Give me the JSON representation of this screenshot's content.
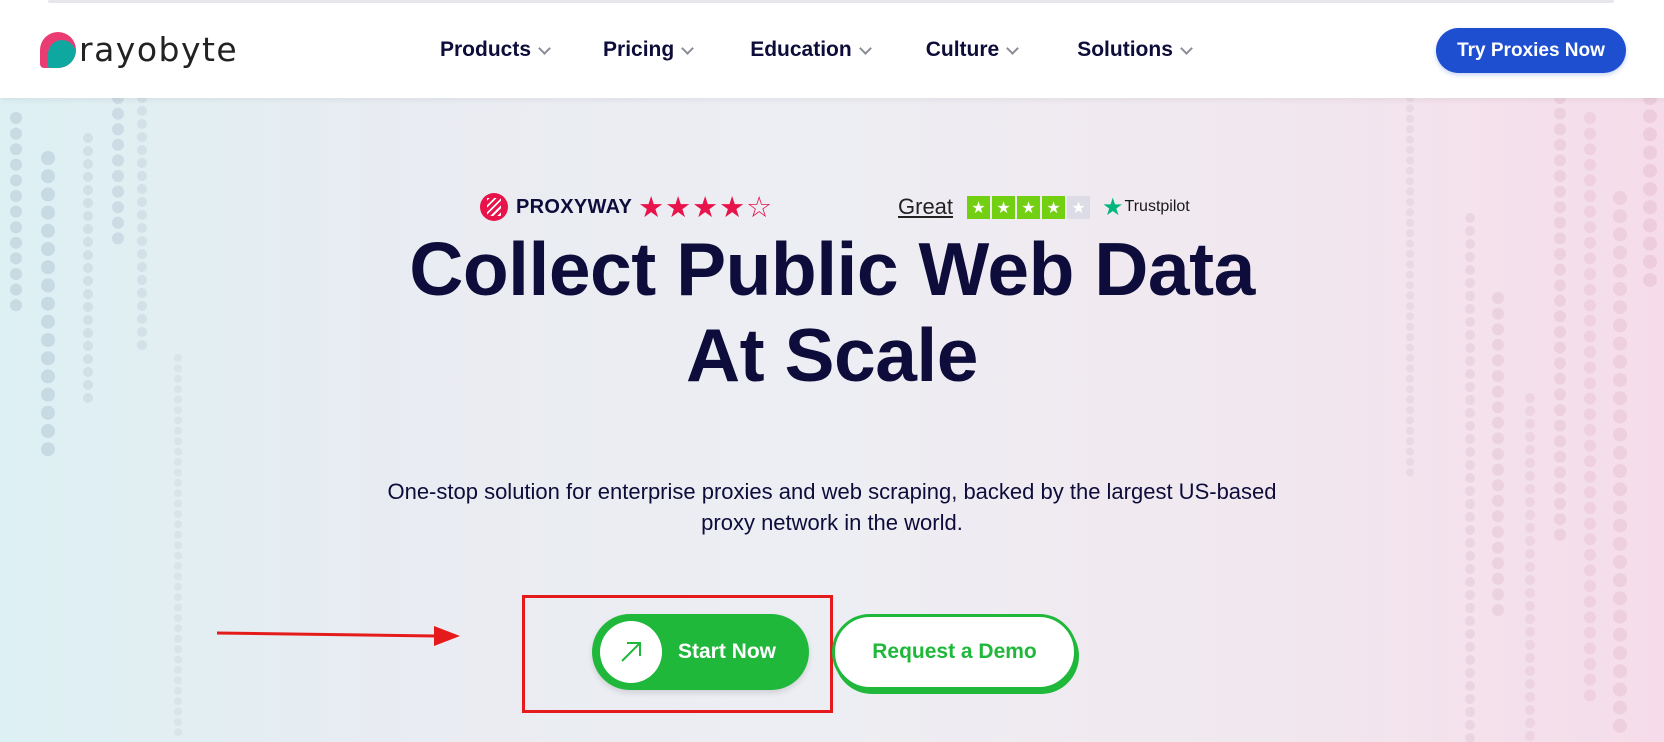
{
  "header": {
    "logo_text": "rayobyte",
    "nav": [
      {
        "label": "Products"
      },
      {
        "label": "Pricing"
      },
      {
        "label": "Education"
      },
      {
        "label": "Culture"
      },
      {
        "label": "Solutions"
      }
    ],
    "cta_label": "Try Proxies Now",
    "cta_color": "#1e4fd0"
  },
  "ratings": {
    "proxyway": {
      "name": "PROXYWAY",
      "stars_filled": 4,
      "stars_total": 5,
      "color": "#e8134a"
    },
    "trustpilot": {
      "label": "Great",
      "stars_filled": 4,
      "stars_total": 5,
      "brand": "Trustpilot",
      "color": "#73cf11"
    }
  },
  "hero": {
    "headline_line1": "Collect Public Web Data",
    "headline_line2": "At Scale",
    "subtext_line1": "One-stop solution for enterprise proxies and web scraping, backed by the largest US-based",
    "subtext_line2": "proxy network in the world.",
    "start_button_label": "Start Now",
    "demo_button_label": "Request a Demo",
    "accent_color": "#1fb83a"
  },
  "annotation": {
    "color": "#e51b1b"
  }
}
